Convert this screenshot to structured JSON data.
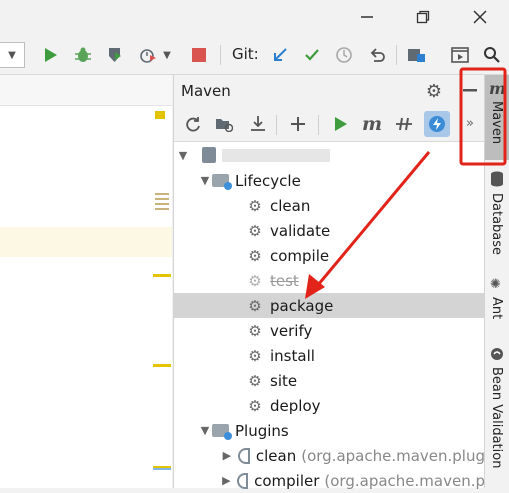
{
  "toolbar": {
    "git_label": "Git:"
  },
  "maven": {
    "title": "Maven",
    "tree": {
      "project": "",
      "lifecycle_label": "Lifecycle",
      "lifecycle": [
        "clean",
        "validate",
        "compile",
        "test",
        "package",
        "verify",
        "install",
        "site",
        "deploy"
      ],
      "plugins_label": "Plugins",
      "plugins": [
        {
          "name": "clean",
          "detail": "(org.apache.maven.plug"
        },
        {
          "name": "compiler",
          "detail": "(org.apache.maven.p"
        }
      ],
      "selected": "package",
      "skipped": "test"
    }
  },
  "stripe": {
    "maven": "Maven",
    "database": "Database",
    "ant": "Ant",
    "bean_validation": "Bean Validation"
  },
  "colors": {
    "annotation_red": "#e2231a",
    "run_green": "#3e9c3e",
    "selection": "#d4d4d4"
  }
}
